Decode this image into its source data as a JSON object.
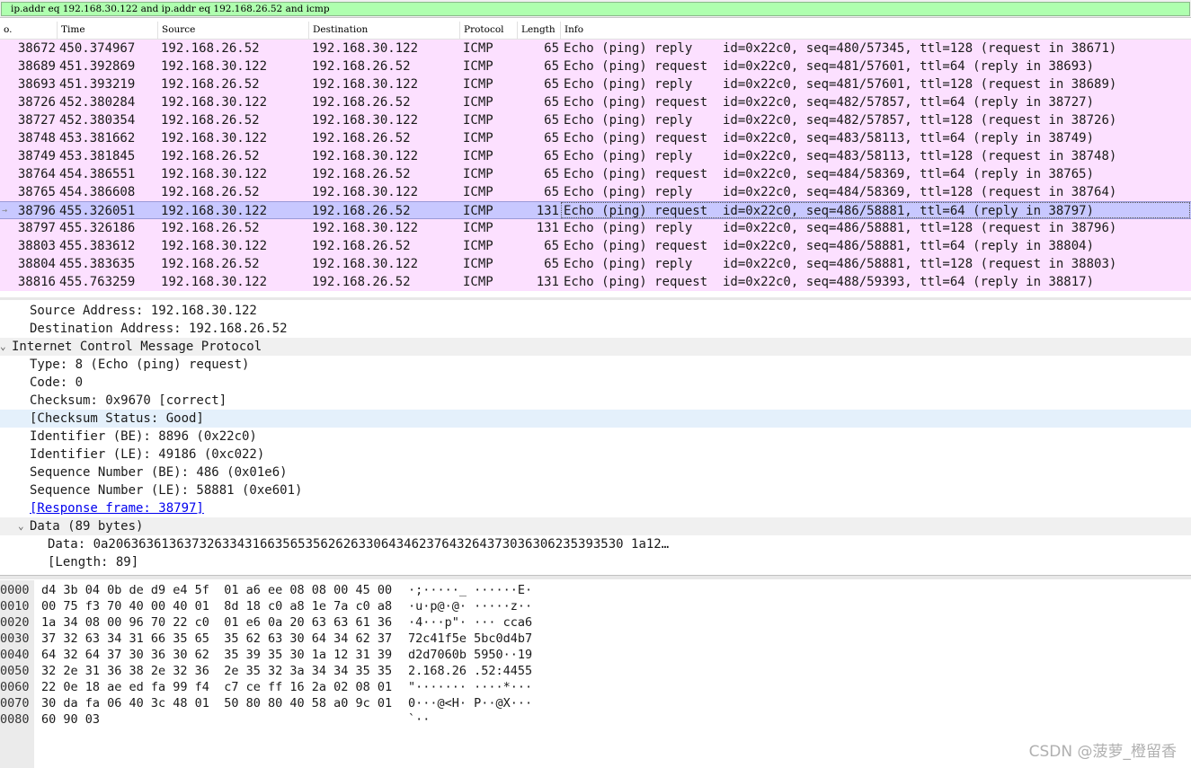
{
  "filter": {
    "value": "ip.addr eq 192.168.30.122 and ip.addr eq 192.168.26.52 and icmp"
  },
  "packet_list": {
    "columns": [
      "o.",
      "Time",
      "Source",
      "Destination",
      "Protocol",
      "Length",
      "Info"
    ],
    "rows": [
      {
        "no": "38672",
        "time": "450.374967",
        "src": "192.168.26.52",
        "dst": "192.168.30.122",
        "proto": "ICMP",
        "len": "65",
        "info": "Echo (ping) reply    id=0x22c0, seq=480/57345, ttl=128 (request in 38671)",
        "selected": false
      },
      {
        "no": "38689",
        "time": "451.392869",
        "src": "192.168.30.122",
        "dst": "192.168.26.52",
        "proto": "ICMP",
        "len": "65",
        "info": "Echo (ping) request  id=0x22c0, seq=481/57601, ttl=64 (reply in 38693)",
        "selected": false
      },
      {
        "no": "38693",
        "time": "451.393219",
        "src": "192.168.26.52",
        "dst": "192.168.30.122",
        "proto": "ICMP",
        "len": "65",
        "info": "Echo (ping) reply    id=0x22c0, seq=481/57601, ttl=128 (request in 38689)",
        "selected": false
      },
      {
        "no": "38726",
        "time": "452.380284",
        "src": "192.168.30.122",
        "dst": "192.168.26.52",
        "proto": "ICMP",
        "len": "65",
        "info": "Echo (ping) request  id=0x22c0, seq=482/57857, ttl=64 (reply in 38727)",
        "selected": false
      },
      {
        "no": "38727",
        "time": "452.380354",
        "src": "192.168.26.52",
        "dst": "192.168.30.122",
        "proto": "ICMP",
        "len": "65",
        "info": "Echo (ping) reply    id=0x22c0, seq=482/57857, ttl=128 (request in 38726)",
        "selected": false
      },
      {
        "no": "38748",
        "time": "453.381662",
        "src": "192.168.30.122",
        "dst": "192.168.26.52",
        "proto": "ICMP",
        "len": "65",
        "info": "Echo (ping) request  id=0x22c0, seq=483/58113, ttl=64 (reply in 38749)",
        "selected": false
      },
      {
        "no": "38749",
        "time": "453.381845",
        "src": "192.168.26.52",
        "dst": "192.168.30.122",
        "proto": "ICMP",
        "len": "65",
        "info": "Echo (ping) reply    id=0x22c0, seq=483/58113, ttl=128 (request in 38748)",
        "selected": false
      },
      {
        "no": "38764",
        "time": "454.386551",
        "src": "192.168.30.122",
        "dst": "192.168.26.52",
        "proto": "ICMP",
        "len": "65",
        "info": "Echo (ping) request  id=0x22c0, seq=484/58369, ttl=64 (reply in 38765)",
        "selected": false
      },
      {
        "no": "38765",
        "time": "454.386608",
        "src": "192.168.26.52",
        "dst": "192.168.30.122",
        "proto": "ICMP",
        "len": "65",
        "info": "Echo (ping) reply    id=0x22c0, seq=484/58369, ttl=128 (request in 38764)",
        "selected": false
      },
      {
        "no": "38796",
        "time": "455.326051",
        "src": "192.168.30.122",
        "dst": "192.168.26.52",
        "proto": "ICMP",
        "len": "131",
        "info": "Echo (ping) request  id=0x22c0, seq=486/58881, ttl=64 (reply in 38797)",
        "selected": true
      },
      {
        "no": "38797",
        "time": "455.326186",
        "src": "192.168.26.52",
        "dst": "192.168.30.122",
        "proto": "ICMP",
        "len": "131",
        "info": "Echo (ping) reply    id=0x22c0, seq=486/58881, ttl=128 (request in 38796)",
        "selected": false
      },
      {
        "no": "38803",
        "time": "455.383612",
        "src": "192.168.30.122",
        "dst": "192.168.26.52",
        "proto": "ICMP",
        "len": "65",
        "info": "Echo (ping) request  id=0x22c0, seq=486/58881, ttl=64 (reply in 38804)",
        "selected": false
      },
      {
        "no": "38804",
        "time": "455.383635",
        "src": "192.168.26.52",
        "dst": "192.168.30.122",
        "proto": "ICMP",
        "len": "65",
        "info": "Echo (ping) reply    id=0x22c0, seq=486/58881, ttl=128 (request in 38803)",
        "selected": false
      },
      {
        "no": "38816",
        "time": "455.763259",
        "src": "192.168.30.122",
        "dst": "192.168.26.52",
        "proto": "ICMP",
        "len": "131",
        "info": "Echo (ping) request  id=0x22c0, seq=488/59393, ttl=64 (reply in 38817)",
        "selected": false
      }
    ]
  },
  "details": [
    {
      "text": "Source Address: 192.168.30.122",
      "indent": 1,
      "style": "",
      "arrow": ""
    },
    {
      "text": "Destination Address: 192.168.26.52",
      "indent": 1,
      "style": "",
      "arrow": ""
    },
    {
      "text": "Internet Control Message Protocol",
      "indent": 0,
      "style": "shade",
      "arrow": "v"
    },
    {
      "text": "Type: 8 (Echo (ping) request)",
      "indent": 1,
      "style": "",
      "arrow": ""
    },
    {
      "text": "Code: 0",
      "indent": 1,
      "style": "",
      "arrow": ""
    },
    {
      "text": "Checksum: 0x9670 [correct]",
      "indent": 1,
      "style": "",
      "arrow": ""
    },
    {
      "text": "[Checksum Status: Good]",
      "indent": 1,
      "style": "hl",
      "arrow": ""
    },
    {
      "text": "Identifier (BE): 8896 (0x22c0)",
      "indent": 1,
      "style": "",
      "arrow": ""
    },
    {
      "text": "Identifier (LE): 49186 (0xc022)",
      "indent": 1,
      "style": "",
      "arrow": ""
    },
    {
      "text": "Sequence Number (BE): 486 (0x01e6)",
      "indent": 1,
      "style": "",
      "arrow": ""
    },
    {
      "text": "Sequence Number (LE): 58881 (0xe601)",
      "indent": 1,
      "style": "",
      "arrow": ""
    },
    {
      "text": "[Response frame: 38797]",
      "indent": 1,
      "style": "link",
      "arrow": ""
    },
    {
      "text": "Data (89 bytes)",
      "indent": 1,
      "style": "shade",
      "arrow": "v"
    },
    {
      "text": "Data: 0a20636361363732633431663565356262633064346237643264373036306235393530 1a12…",
      "indent": 2,
      "style": "",
      "arrow": ""
    },
    {
      "text": "[Length: 89]",
      "indent": 2,
      "style": "",
      "arrow": ""
    }
  ],
  "bytes": [
    {
      "offset": "0000",
      "hex": "d4 3b 04 0b de d9 e4 5f  01 a6 ee 08 08 00 45 00",
      "ascii": "·;·····_ ······E·"
    },
    {
      "offset": "0010",
      "hex": "00 75 f3 70 40 00 40 01  8d 18 c0 a8 1e 7a c0 a8",
      "ascii": "·u·p@·@· ·····z··"
    },
    {
      "offset": "0020",
      "hex": "1a 34 08 00 96 70 22 c0  01 e6 0a 20 63 63 61 36",
      "ascii": "·4···p\"· ··· cca6"
    },
    {
      "offset": "0030",
      "hex": "37 32 63 34 31 66 35 65  35 62 63 30 64 34 62 37",
      "ascii": "72c41f5e 5bc0d4b7"
    },
    {
      "offset": "0040",
      "hex": "64 32 64 37 30 36 30 62  35 39 35 30 1a 12 31 39",
      "ascii": "d2d7060b 5950··19"
    },
    {
      "offset": "0050",
      "hex": "32 2e 31 36 38 2e 32 36  2e 35 32 3a 34 34 35 35",
      "ascii": "2.168.26 .52:4455"
    },
    {
      "offset": "0060",
      "hex": "22 0e 18 ae ed fa 99 f4  c7 ce ff 16 2a 02 08 01",
      "ascii": "\"······· ····*···"
    },
    {
      "offset": "0070",
      "hex": "30 da fa 06 40 3c 48 01  50 80 80 40 58 a0 9c 01",
      "ascii": "0···@<H· P··@X···"
    },
    {
      "offset": "0080",
      "hex": "60 90 03",
      "ascii": "`··"
    }
  ],
  "watermark": "CSDN @菠萝_橙留香"
}
